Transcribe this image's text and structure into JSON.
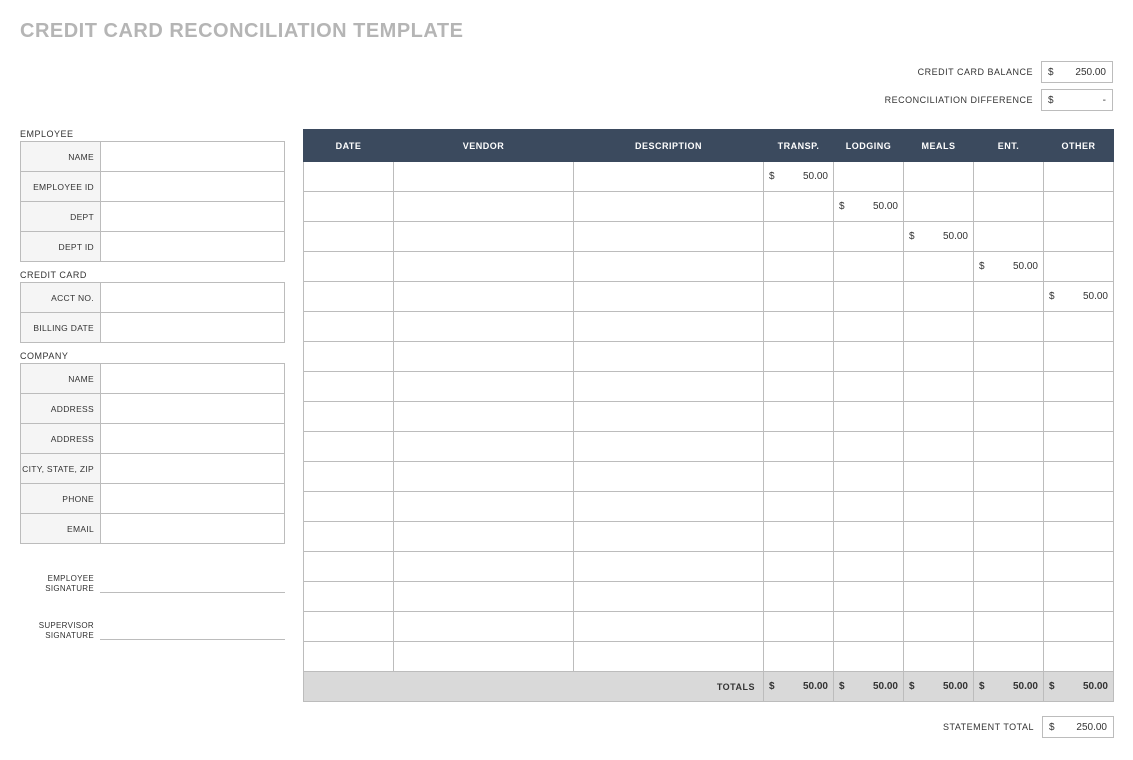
{
  "title": "CREDIT CARD RECONCILIATION TEMPLATE",
  "summary": {
    "balance_label": "CREDIT CARD BALANCE",
    "balance_currency": "$",
    "balance_value": "250.00",
    "diff_label": "RECONCILIATION DIFFERENCE",
    "diff_currency": "$",
    "diff_value": "-",
    "statement_total_label": "STATEMENT TOTAL",
    "statement_total_currency": "$",
    "statement_total_value": "250.00"
  },
  "left": {
    "employee": {
      "section": "EMPLOYEE",
      "rows": [
        {
          "label": "NAME",
          "value": ""
        },
        {
          "label": "EMPLOYEE ID",
          "value": ""
        },
        {
          "label": "DEPT",
          "value": ""
        },
        {
          "label": "DEPT ID",
          "value": ""
        }
      ]
    },
    "card": {
      "section": "CREDIT CARD",
      "rows": [
        {
          "label": "ACCT NO.",
          "value": ""
        },
        {
          "label": "BILLING DATE",
          "value": ""
        }
      ]
    },
    "company": {
      "section": "COMPANY",
      "rows": [
        {
          "label": "NAME",
          "value": ""
        },
        {
          "label": "ADDRESS",
          "value": ""
        },
        {
          "label": "ADDRESS",
          "value": ""
        },
        {
          "label": "CITY, STATE, ZIP",
          "value": ""
        },
        {
          "label": "PHONE",
          "value": ""
        },
        {
          "label": "EMAIL",
          "value": ""
        }
      ]
    },
    "signatures": {
      "employee": "EMPLOYEE SIGNATURE",
      "supervisor": "SUPERVISOR SIGNATURE"
    }
  },
  "table": {
    "headers": {
      "date": "DATE",
      "vendor": "VENDOR",
      "description": "DESCRIPTION",
      "transp": "TRANSP.",
      "lodging": "LODGING",
      "meals": "MEALS",
      "ent": "ENT.",
      "other": "OTHER"
    },
    "currency": "$",
    "rows": [
      {
        "transp": "50.00",
        "lodging": "",
        "meals": "",
        "ent": "",
        "other": ""
      },
      {
        "transp": "",
        "lodging": "50.00",
        "meals": "",
        "ent": "",
        "other": ""
      },
      {
        "transp": "",
        "lodging": "",
        "meals": "50.00",
        "ent": "",
        "other": ""
      },
      {
        "transp": "",
        "lodging": "",
        "meals": "",
        "ent": "50.00",
        "other": ""
      },
      {
        "transp": "",
        "lodging": "",
        "meals": "",
        "ent": "",
        "other": "50.00"
      },
      {
        "transp": "",
        "lodging": "",
        "meals": "",
        "ent": "",
        "other": ""
      },
      {
        "transp": "",
        "lodging": "",
        "meals": "",
        "ent": "",
        "other": ""
      },
      {
        "transp": "",
        "lodging": "",
        "meals": "",
        "ent": "",
        "other": ""
      },
      {
        "transp": "",
        "lodging": "",
        "meals": "",
        "ent": "",
        "other": ""
      },
      {
        "transp": "",
        "lodging": "",
        "meals": "",
        "ent": "",
        "other": ""
      },
      {
        "transp": "",
        "lodging": "",
        "meals": "",
        "ent": "",
        "other": ""
      },
      {
        "transp": "",
        "lodging": "",
        "meals": "",
        "ent": "",
        "other": ""
      },
      {
        "transp": "",
        "lodging": "",
        "meals": "",
        "ent": "",
        "other": ""
      },
      {
        "transp": "",
        "lodging": "",
        "meals": "",
        "ent": "",
        "other": ""
      },
      {
        "transp": "",
        "lodging": "",
        "meals": "",
        "ent": "",
        "other": ""
      },
      {
        "transp": "",
        "lodging": "",
        "meals": "",
        "ent": "",
        "other": ""
      },
      {
        "transp": "",
        "lodging": "",
        "meals": "",
        "ent": "",
        "other": ""
      }
    ],
    "totals": {
      "label": "TOTALS",
      "transp": "50.00",
      "lodging": "50.00",
      "meals": "50.00",
      "ent": "50.00",
      "other": "50.00"
    }
  }
}
